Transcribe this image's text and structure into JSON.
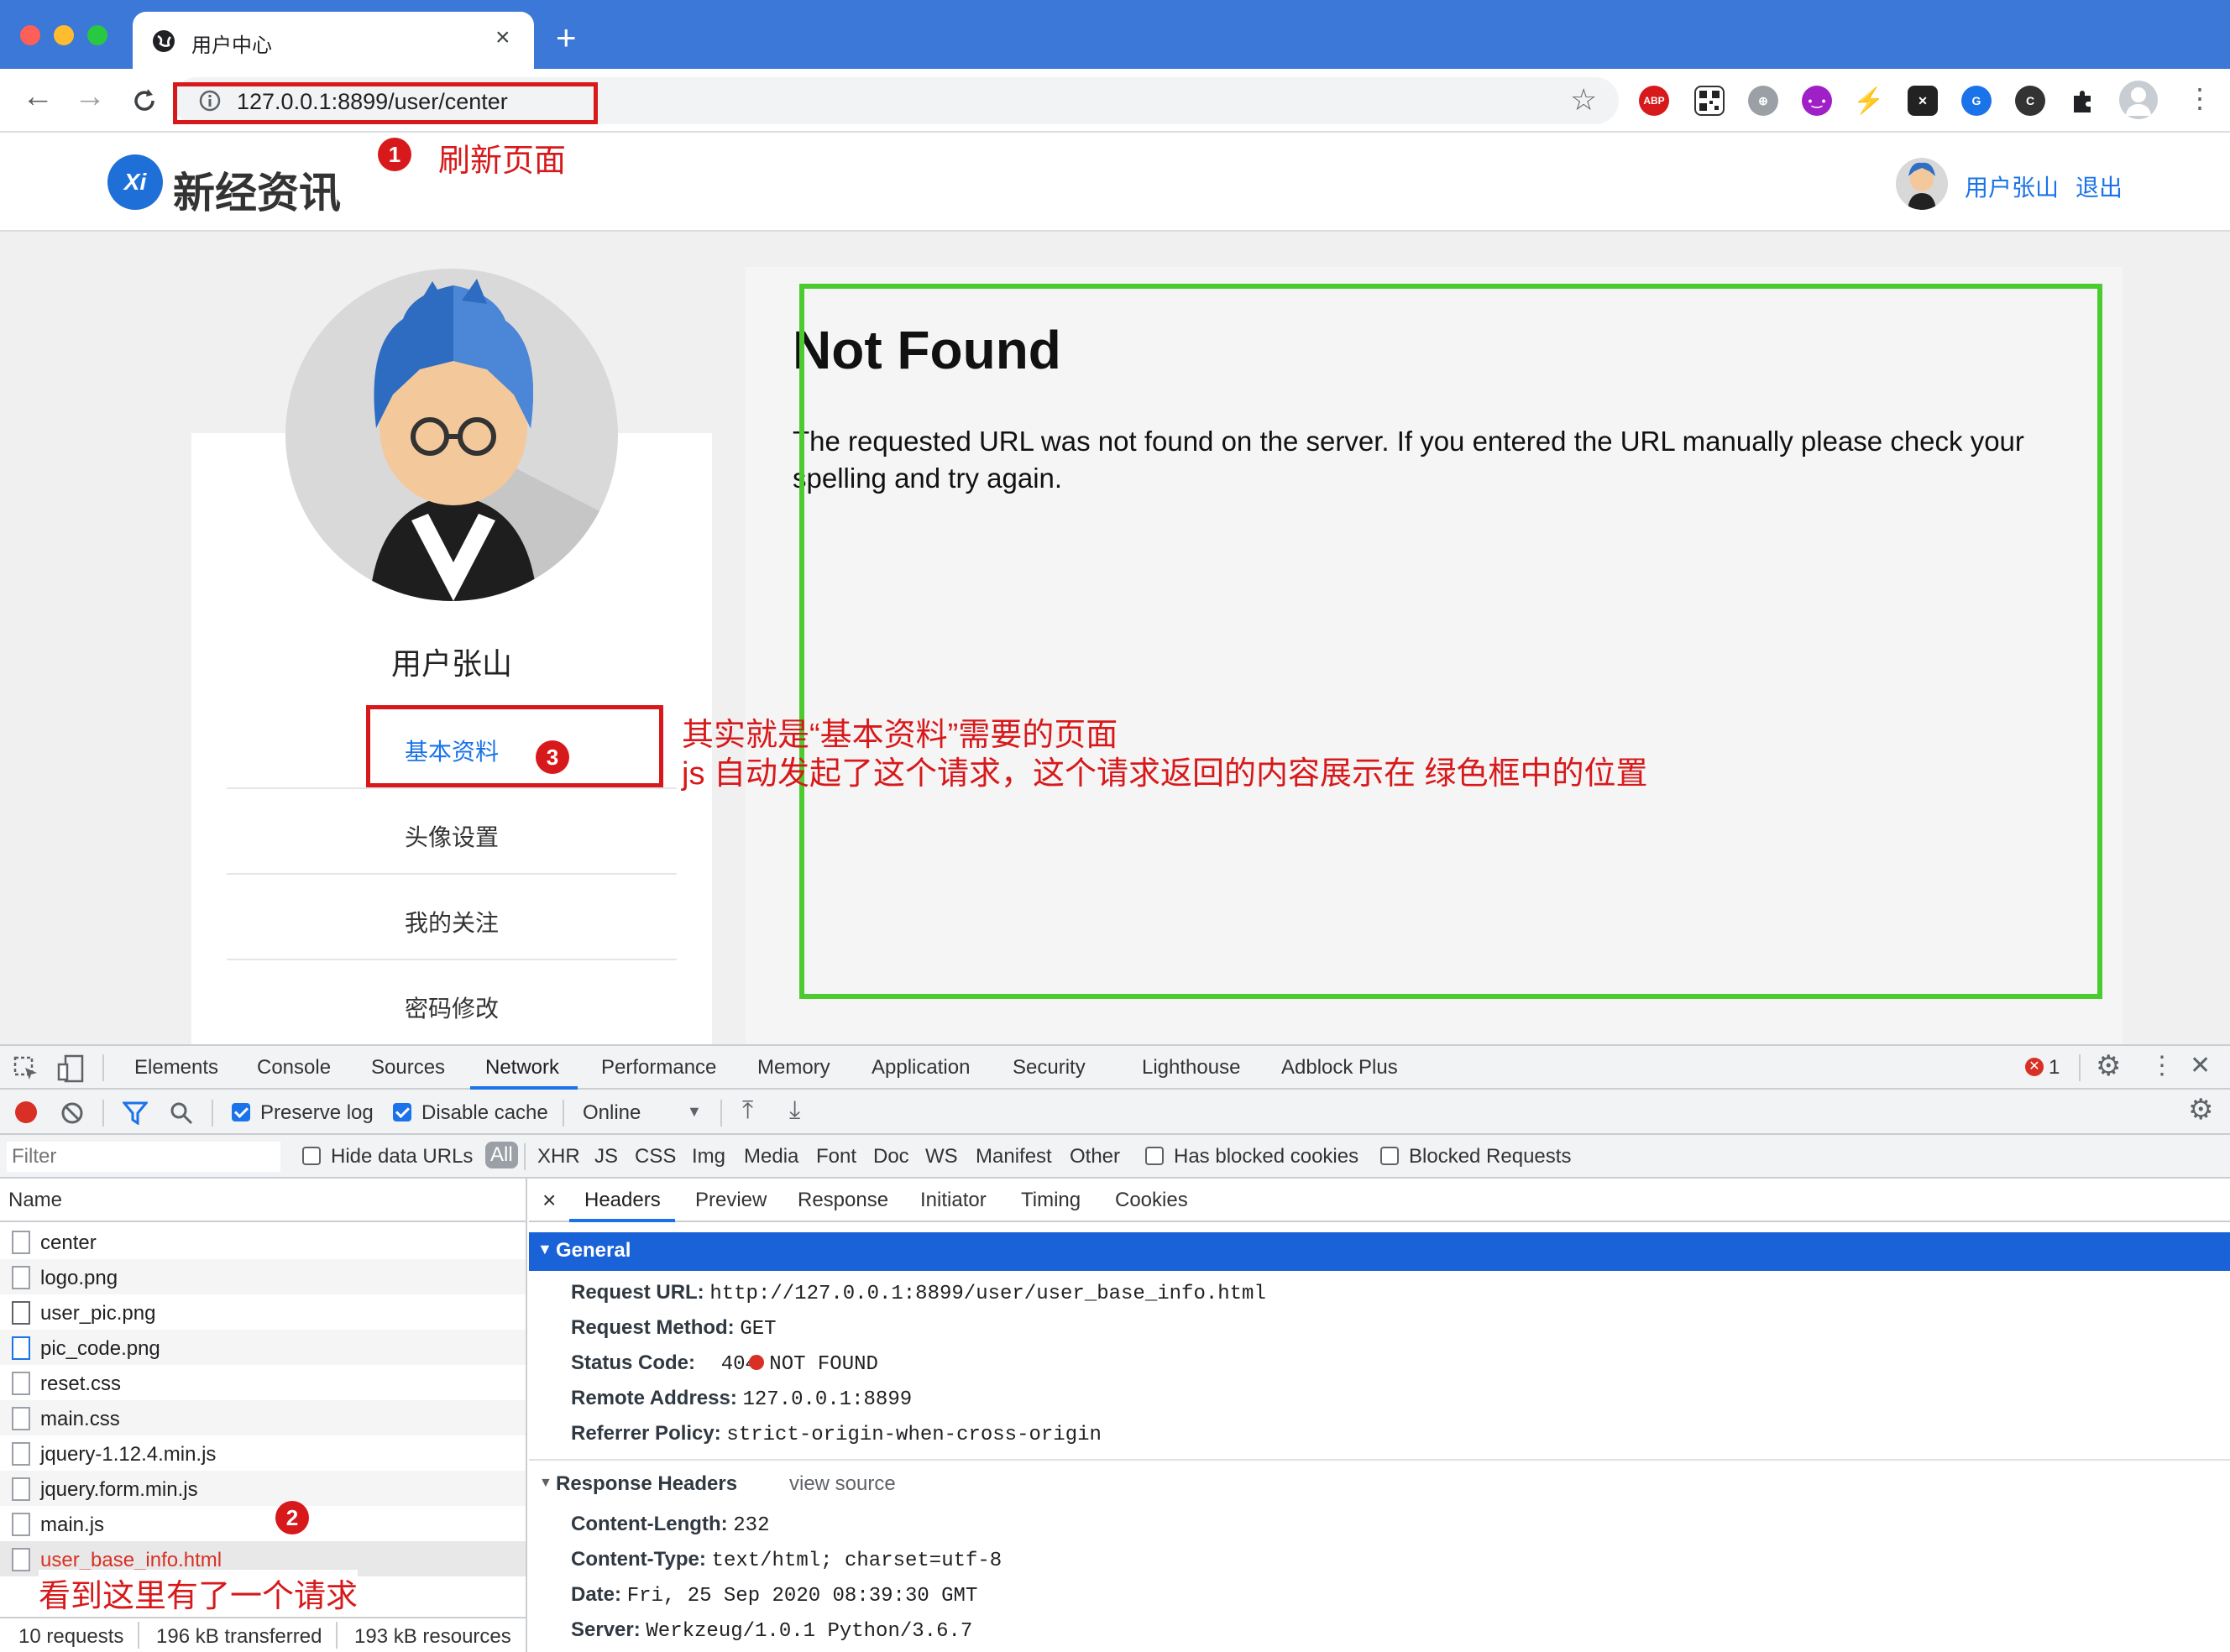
{
  "browser": {
    "tab_title": "用户中心",
    "new_tab": "+",
    "close_tab": "×",
    "url": "127.0.0.1:8899/user/center"
  },
  "site": {
    "logo_mark": "Xi",
    "logo_text": "新经资讯",
    "user_name_link": "用户张山",
    "logout_link": "退出",
    "profile_name": "用户张山",
    "menu": [
      "基本资料",
      "头像设置",
      "我的关注",
      "密码修改"
    ]
  },
  "content": {
    "title": "Not Found",
    "message": "The requested URL was not found on the server. If you entered the URL manually please check your spelling and try again."
  },
  "annotations": {
    "step1_num": "1",
    "step1_text": "刷新页面",
    "step2_num": "2",
    "step2_text": "看到这里有了一个请求",
    "step3_num": "3",
    "step3_line1": "其实就是“基本资料”需要的页面",
    "step3_line2": "js 自动发起了这个请求，这个请求返回的内容展示在 绿色框中的位置"
  },
  "devtools": {
    "tabs": [
      "Elements",
      "Console",
      "Sources",
      "Network",
      "Performance",
      "Memory",
      "Application",
      "Security",
      "Lighthouse",
      "Adblock Plus"
    ],
    "active_tab": "Network",
    "error_count": "1",
    "preserve_log": "Preserve log",
    "disable_cache": "Disable cache",
    "throttle": "Online",
    "filter_placeholder": "Filter",
    "hide_data_urls": "Hide data URLs",
    "type_filters": [
      "All",
      "XHR",
      "JS",
      "CSS",
      "Img",
      "Media",
      "Font",
      "Doc",
      "WS",
      "Manifest",
      "Other"
    ],
    "has_blocked_cookies": "Has blocked cookies",
    "blocked_requests": "Blocked Requests",
    "name_header": "Name",
    "requests": [
      "center",
      "logo.png",
      "user_pic.png",
      "pic_code.png",
      "reset.css",
      "main.css",
      "jquery-1.12.4.min.js",
      "jquery.form.min.js",
      "main.js",
      "user_base_info.html"
    ],
    "status": {
      "requests": "10 requests",
      "transferred": "196 kB transferred",
      "resources": "193 kB resources"
    },
    "detail_tabs": [
      "Headers",
      "Preview",
      "Response",
      "Initiator",
      "Timing",
      "Cookies"
    ],
    "detail_close": "×",
    "general_label": "General",
    "general": [
      {
        "k": "Request URL:",
        "v": "http://127.0.0.1:8899/user/user_base_info.html"
      },
      {
        "k": "Request Method:",
        "v": "GET"
      },
      {
        "k": "Status Code:",
        "v": "404 NOT FOUND"
      },
      {
        "k": "Remote Address:",
        "v": "127.0.0.1:8899"
      },
      {
        "k": "Referrer Policy:",
        "v": "strict-origin-when-cross-origin"
      }
    ],
    "response_headers_label": "Response Headers",
    "view_source": "view source",
    "response_headers": [
      {
        "k": "Content-Length:",
        "v": "232"
      },
      {
        "k": "Content-Type:",
        "v": "text/html; charset=utf-8"
      },
      {
        "k": "Date:",
        "v": "Fri, 25 Sep 2020 08:39:30 GMT"
      },
      {
        "k": "Server:",
        "v": "Werkzeug/1.0.1 Python/3.6.7"
      }
    ]
  },
  "colors": {
    "annotation": "#d7191b",
    "highlight_box": "#4ccb31",
    "link": "#1a73e8",
    "tab_bar": "#3b78d8"
  }
}
